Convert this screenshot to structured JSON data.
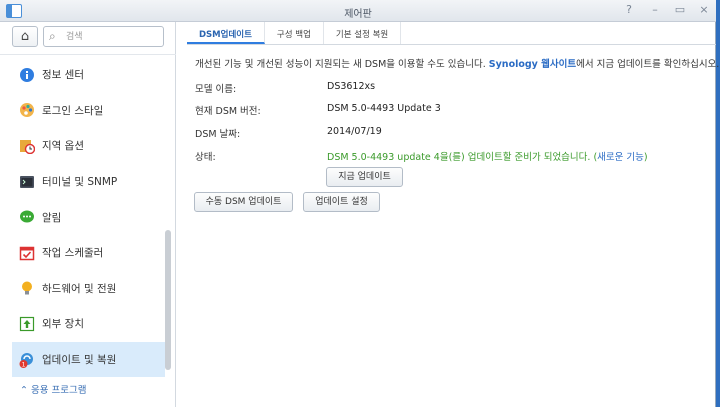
{
  "window": {
    "title": "제어판"
  },
  "sidebar": {
    "search_placeholder": "검색",
    "items": [
      {
        "label": "정보 센터"
      },
      {
        "label": "로그인 스타일"
      },
      {
        "label": "지역 옵션"
      },
      {
        "label": "터미널 및 SNMP"
      },
      {
        "label": "알림"
      },
      {
        "label": "작업 스케줄러"
      },
      {
        "label": "하드웨어 및 전원"
      },
      {
        "label": "외부 장치"
      },
      {
        "label": "업데이트 및 복원",
        "badge": "1"
      }
    ],
    "apps_link": "응용 프로그램"
  },
  "tabs": [
    {
      "label": "DSM업데이트"
    },
    {
      "label": "구성 백업"
    },
    {
      "label": "기본 설정 복원"
    }
  ],
  "main": {
    "description": {
      "before": "개선된 기능 및 개선된 성능이 지원되는 새 DSM을 이용할 수도 있습니다. ",
      "link": "Synology 웹사이트",
      "after": "에서 지금 업데이트를 확인하십시오."
    },
    "model": {
      "label": "모델 이름:",
      "value": "DS3612xs"
    },
    "version": {
      "label": "현재 DSM 버전:",
      "value": "DSM 5.0-4493 Update 3"
    },
    "date": {
      "label": "DSM 날짜:",
      "value": "2014/07/19"
    },
    "status": {
      "label": "상태:",
      "value": "DSM 5.0-4493 update 4을(를) 업데이트할 준비가 되었습니다.",
      "paren_open": " (",
      "link": "새로운 기능",
      "paren_close": ")"
    },
    "update_now_button": "지금 업데이트",
    "manual_update_button": "수동 DSM 업데이트",
    "update_settings_button": "업데이트 설정"
  },
  "colors": {
    "accent": "#2f7de0",
    "status_ok": "#3a9a2a",
    "link": "#2a6bc4"
  }
}
